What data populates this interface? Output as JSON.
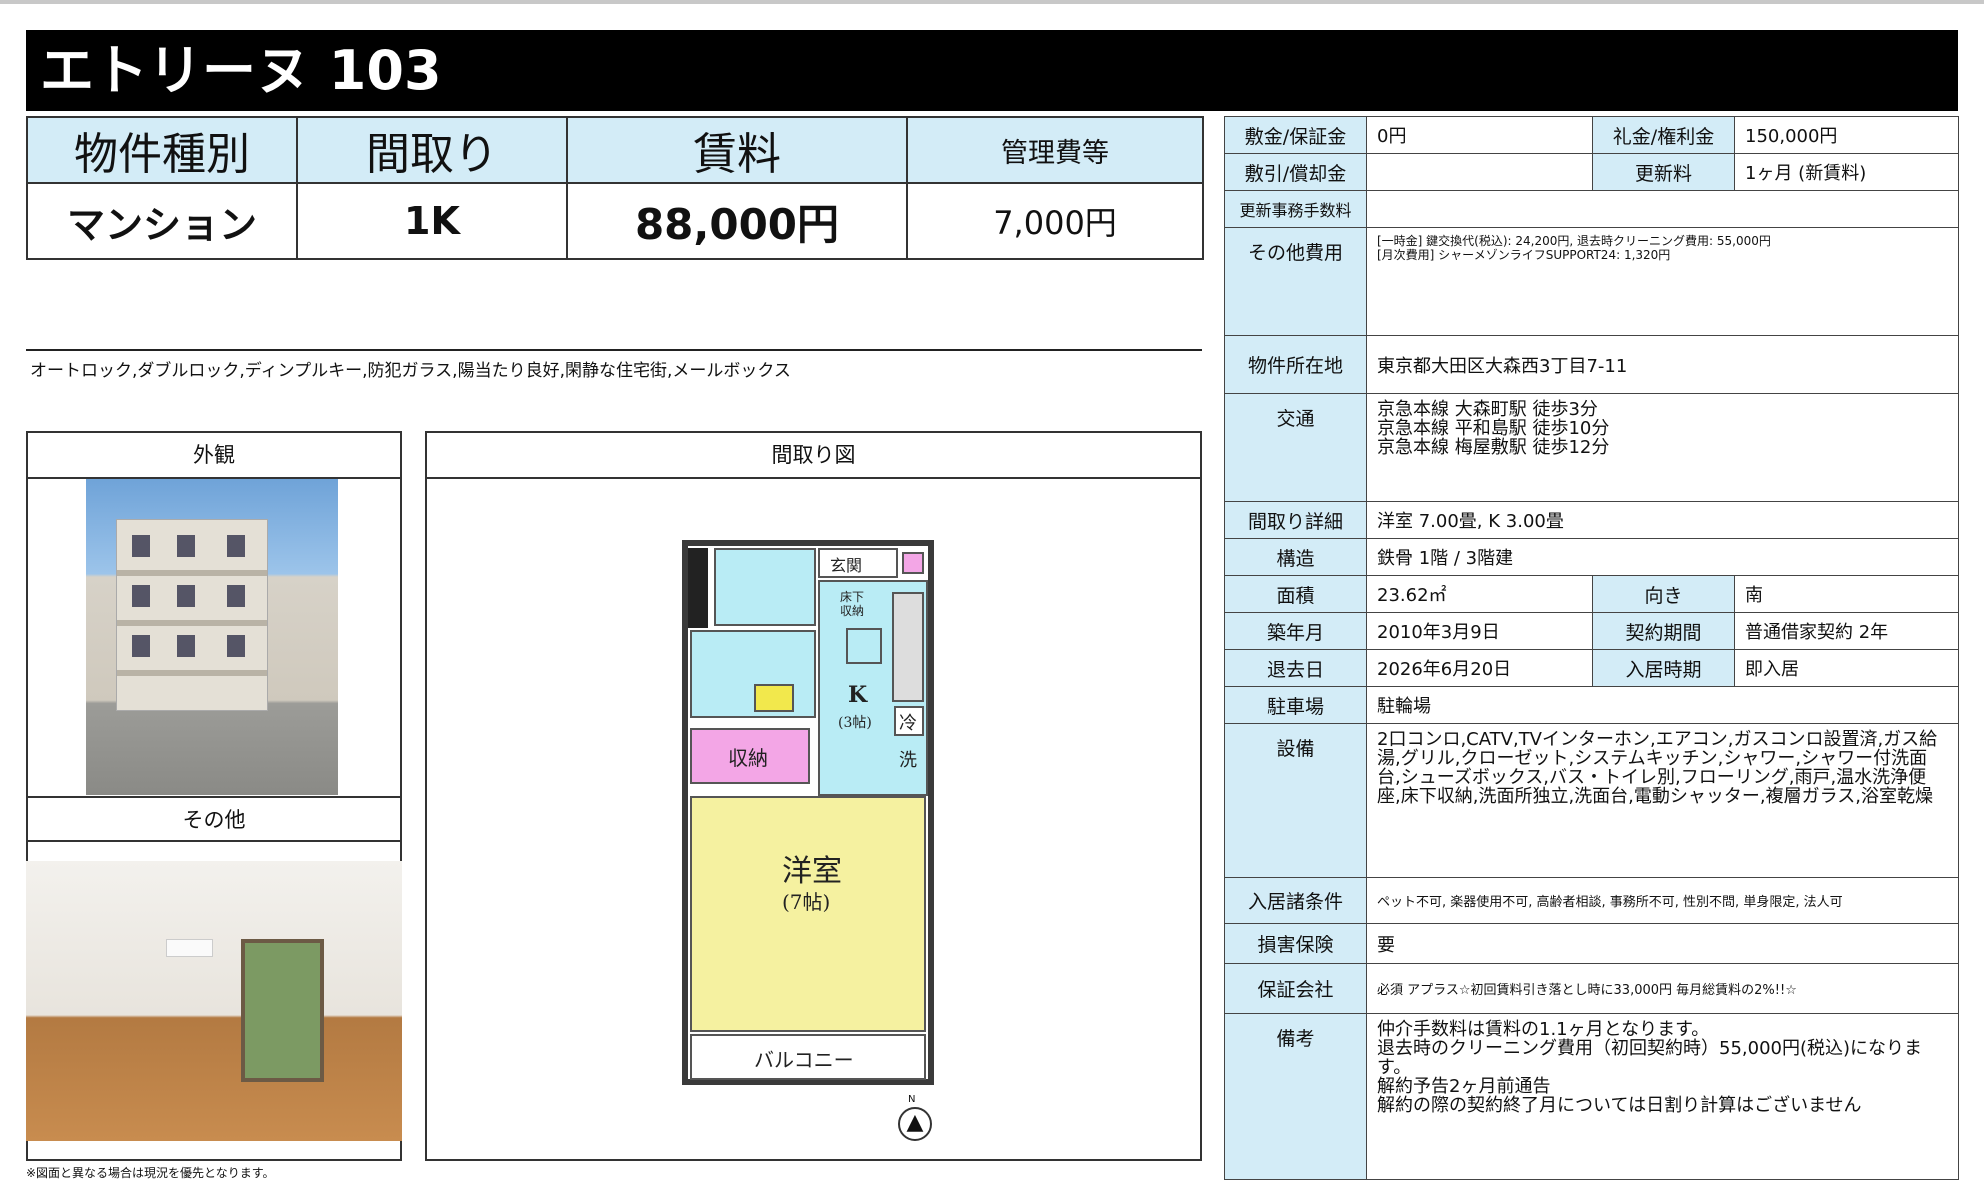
{
  "title": "エトリーヌ 103",
  "summary": {
    "headers": [
      "物件種別",
      "間取り",
      "賃料",
      "管理費等"
    ],
    "values": [
      "マンション",
      "1K",
      "88,000円",
      "7,000円"
    ]
  },
  "features": "オートロック,ダブルロック,ディンプルキー,防犯ガラス,陽当たり良好,閑静な住宅街,メールボックス",
  "photos": {
    "exterior_label": "外観",
    "other_label": "その他",
    "floorplan_label": "間取り図"
  },
  "floorplan": {
    "entrance": "玄関",
    "hall_storage": "床下\n収納",
    "kitchen": "K",
    "kitchen_size": "(3帖)",
    "fridge": "冷",
    "washer": "洗",
    "storage": "収納",
    "room": "洋室",
    "room_size": "(7帖)",
    "balcony": "バルコニー",
    "north": "N"
  },
  "footnote": "※図面と異なる場合は現況を優先となります。",
  "details": {
    "deposit_label": "敷金/保証金",
    "deposit": "0円",
    "key_money_label": "礼金/権利金",
    "key_money": "150,000円",
    "deduction_label": "敷引/償却金",
    "deduction": "",
    "renewal_label": "更新料",
    "renewal": "1ヶ月 (新賃料)",
    "renewal_fee_label": "更新事務手数料",
    "renewal_fee": "",
    "other_costs_label": "その他費用",
    "other_costs_1": "[一時金] 鍵交換代(税込): 24,200円, 退去時クリーニング費用: 55,000円",
    "other_costs_2": "[月次費用] シャーメゾンライフSUPPORT24: 1,320円",
    "address_label": "物件所在地",
    "address": "東京都大田区大森西3丁目7-11",
    "transit_label": "交通",
    "transit": [
      "京急本線 大森町駅 徒歩3分",
      "京急本線 平和島駅 徒歩10分",
      "京急本線 梅屋敷駅 徒歩12分"
    ],
    "layout_detail_label": "間取り詳細",
    "layout_detail": "洋室 7.00畳, K 3.00畳",
    "structure_label": "構造",
    "structure": "鉄骨 1階 / 3階建",
    "area_label": "面積",
    "area": "23.62㎡",
    "orientation_label": "向き",
    "orientation": "南",
    "built_label": "築年月",
    "built": "2010年3月9日",
    "contract_label": "契約期間",
    "contract": "普通借家契約 2年",
    "vacate_label": "退去日",
    "vacate": "2026年6月20日",
    "move_in_label": "入居時期",
    "move_in": "即入居",
    "parking_label": "駐車場",
    "parking": "駐輪場",
    "equipment_label": "設備",
    "equipment": "2口コンロ,CATV,TVインターホン,エアコン,ガスコンロ設置済,ガス給湯,グリル,クローゼット,システムキッチン,シャワー,シャワー付洗面台,シューズボックス,バス・トイレ別,フローリング,雨戸,温水洗浄便座,床下収納,洗面所独立,洗面台,電動シャッター,複層ガラス,浴室乾燥",
    "conditions_label": "入居諸条件",
    "conditions": "ペット不可, 楽器使用不可, 高齢者相談, 事務所不可, 性別不問, 単身限定, 法人可",
    "insurance_label": "損害保険",
    "insurance": "要",
    "guarantor_label": "保証会社",
    "guarantor": "必須 アプラス☆初回賃料引き落とし時に33,000円 毎月総賃料の2%!!☆",
    "remarks_label": "備考",
    "remarks": [
      "仲介手数料は賃料の1.1ヶ月となります。",
      "退去時のクリーニング費用（初回契約時）55,000円(税込)になります。",
      "解約予告2ヶ月前通告",
      "解約の際の契約終了月については日割り計算はございません"
    ]
  }
}
